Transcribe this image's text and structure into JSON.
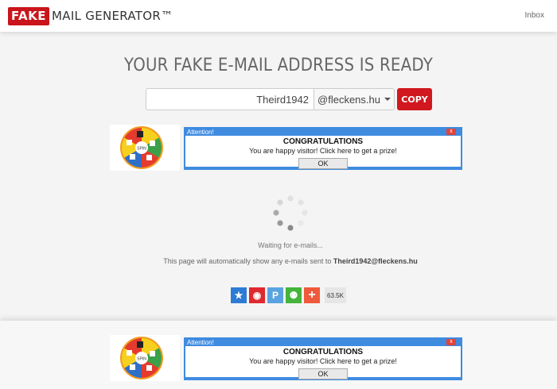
{
  "logo": {
    "box": "FAKE",
    "rest": "MAIL GENERATOR™"
  },
  "nav": {
    "inbox": "Inbox"
  },
  "headline": "YOUR FAKE E-MAIL ADDRESS IS READY",
  "form": {
    "name_value": "Theird1942",
    "domain": "@fleckens.hu",
    "copy_label": "COPY"
  },
  "ad": {
    "wheel_center": "SPIN",
    "title": "Attention!",
    "close": "x",
    "heading": "CONGRATULATIONS",
    "message": "You are happy visitor!  Click here to get a prize!",
    "ok": "OK"
  },
  "status": {
    "waiting": "Waiting for e-mails...",
    "autoshow_prefix": "This page will automatically show any e-mails sent to ",
    "address": "Theird1942@fleckens.hu"
  },
  "share": {
    "buttons": [
      {
        "icon": "star-share-icon",
        "color": "#2d7bd4",
        "glyph": "★"
      },
      {
        "icon": "weibo-icon",
        "color": "#e0282f",
        "glyph": "◉"
      },
      {
        "icon": "pinyin-icon",
        "color": "#5aa3e0",
        "glyph": "P"
      },
      {
        "icon": "wechat-icon",
        "color": "#45b43a",
        "glyph": "⚉"
      },
      {
        "icon": "plus-icon",
        "color": "#f05a3c",
        "glyph": "+"
      }
    ],
    "count": "63.5K"
  },
  "colors": {
    "brand": "#c9151b",
    "popup_border": "#3f8be0"
  }
}
